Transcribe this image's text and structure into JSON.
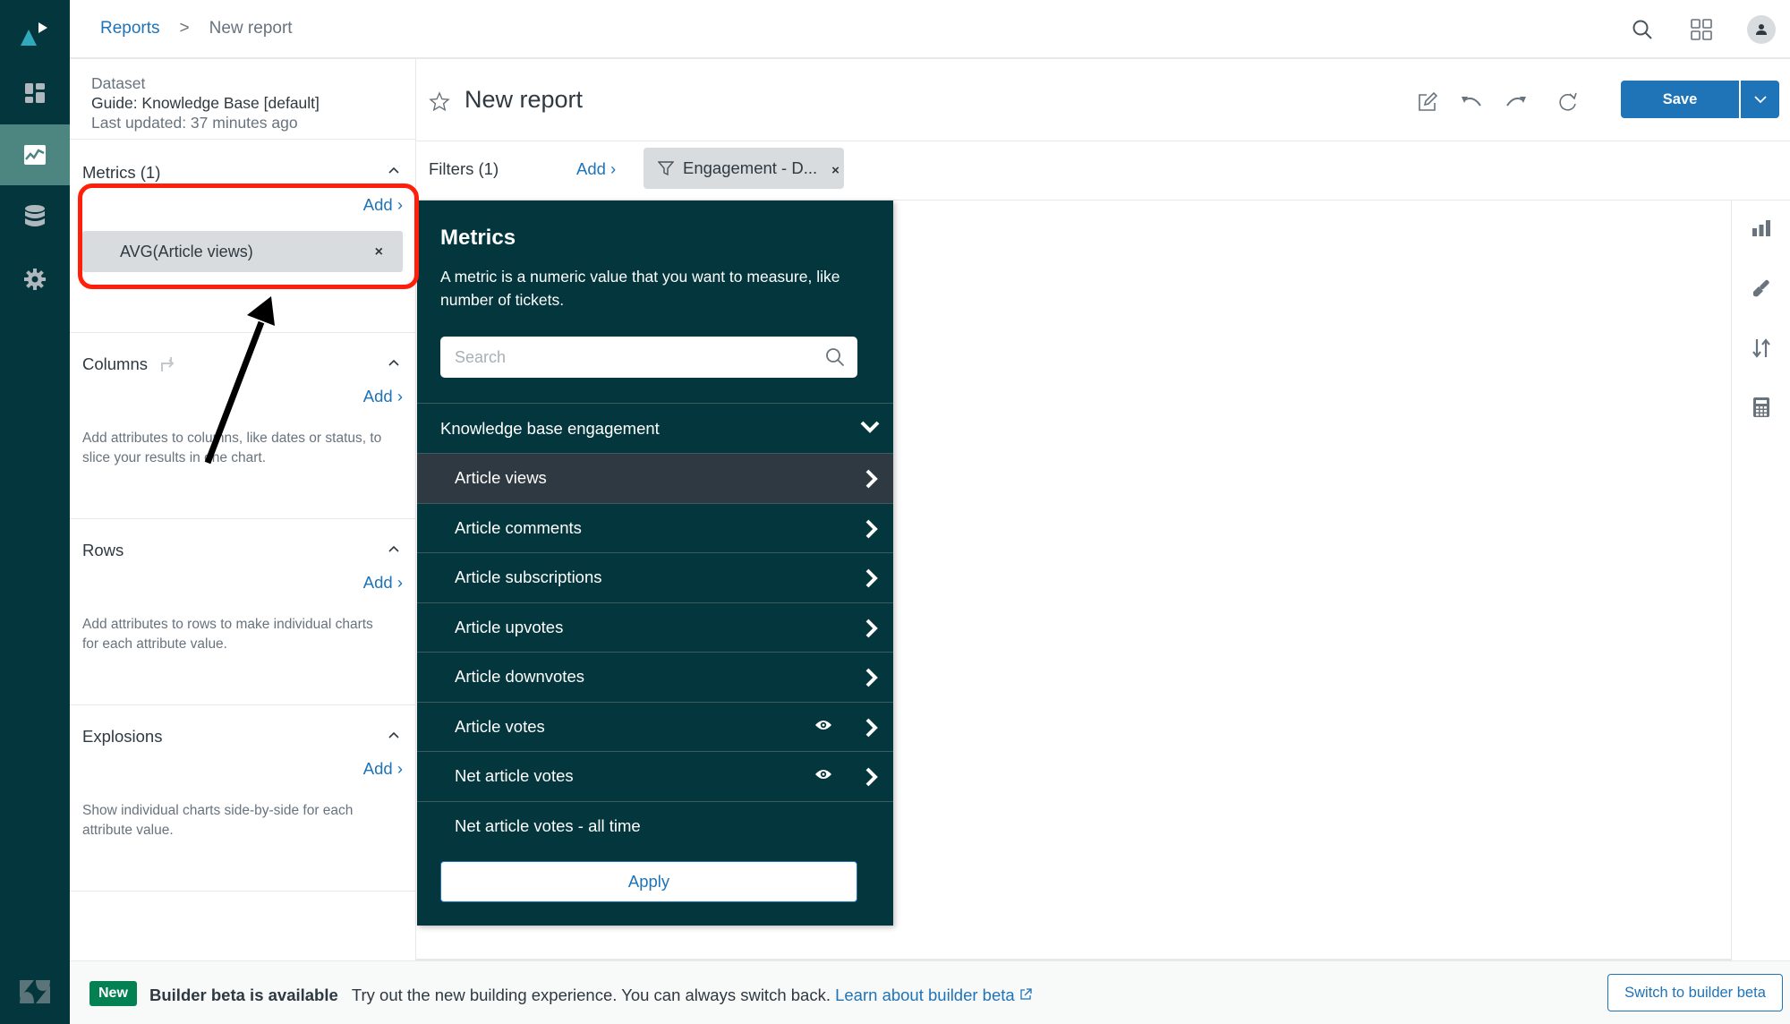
{
  "nav": {
    "items": [
      {
        "name": "dashboard",
        "icon": "dashboard-icon",
        "active": false
      },
      {
        "name": "reports",
        "icon": "chart-line-icon",
        "active": true
      },
      {
        "name": "datasets",
        "icon": "database-icon",
        "active": false
      },
      {
        "name": "settings",
        "icon": "gear-icon",
        "active": false
      }
    ]
  },
  "header": {
    "breadcrumb": {
      "parent": "Reports",
      "separator": ">",
      "current": "New report"
    },
    "icons": [
      "search-icon",
      "apps-grid-icon",
      "avatar-user-icon"
    ]
  },
  "config": {
    "dataset": {
      "label": "Dataset",
      "name": "Guide: Knowledge Base [default]",
      "updated": "Last updated: 37 minutes ago"
    },
    "metrics": {
      "title": "Metrics (1)",
      "add": "Add ›",
      "chip": "AVG(Article views)",
      "chip_close": "×"
    },
    "columns": {
      "title": "Columns",
      "add": "Add ›",
      "help": "Add attributes to columns, like dates or status, to slice your results in one chart."
    },
    "rows": {
      "title": "Rows",
      "add": "Add ›",
      "help": "Add attributes to rows to make individual charts for each attribute value."
    },
    "explosions": {
      "title": "Explosions",
      "add": "Add ›",
      "help": "Show individual charts side-by-side for each attribute value."
    }
  },
  "report": {
    "title": "New report",
    "toolbar": [
      "edit-icon",
      "undo-icon",
      "redo-icon",
      "refresh-icon"
    ],
    "save_label": "Save"
  },
  "filters": {
    "label": "Filters (1)",
    "add": "Add ›",
    "pill": "Engagement - D...",
    "pill_close": "×"
  },
  "right_tools": [
    "chart-type-icon",
    "paintbrush-icon",
    "sort-icon",
    "calculator-icon"
  ],
  "picker": {
    "title": "Metrics",
    "description": "A metric is a numeric value that you want to measure, like number of tickets.",
    "search_placeholder": "Search",
    "search_value": "",
    "group": "Knowledge base engagement",
    "items": [
      {
        "label": "Article views",
        "hover": true,
        "eye": false,
        "arrow": true
      },
      {
        "label": "Article comments",
        "hover": false,
        "eye": false,
        "arrow": true
      },
      {
        "label": "Article subscriptions",
        "hover": false,
        "eye": false,
        "arrow": true
      },
      {
        "label": "Article upvotes",
        "hover": false,
        "eye": false,
        "arrow": true
      },
      {
        "label": "Article downvotes",
        "hover": false,
        "eye": false,
        "arrow": true
      },
      {
        "label": "Article votes",
        "hover": false,
        "eye": true,
        "arrow": true
      },
      {
        "label": "Net article votes",
        "hover": false,
        "eye": true,
        "arrow": true
      },
      {
        "label": "Net article votes - all time",
        "hover": false,
        "eye": false,
        "arrow": false
      }
    ],
    "apply_label": "Apply"
  },
  "banner": {
    "badge": "New",
    "headline": "Builder beta is available",
    "text": "Try out the new building experience. You can always switch back.",
    "link": "Learn about builder beta",
    "button": "Switch to builder beta"
  },
  "colors": {
    "rail": "#03363d",
    "rail_active": "#4d8581",
    "primary": "#1f73b7",
    "annotation": "#ff1f0a",
    "badge_green": "#038153"
  }
}
